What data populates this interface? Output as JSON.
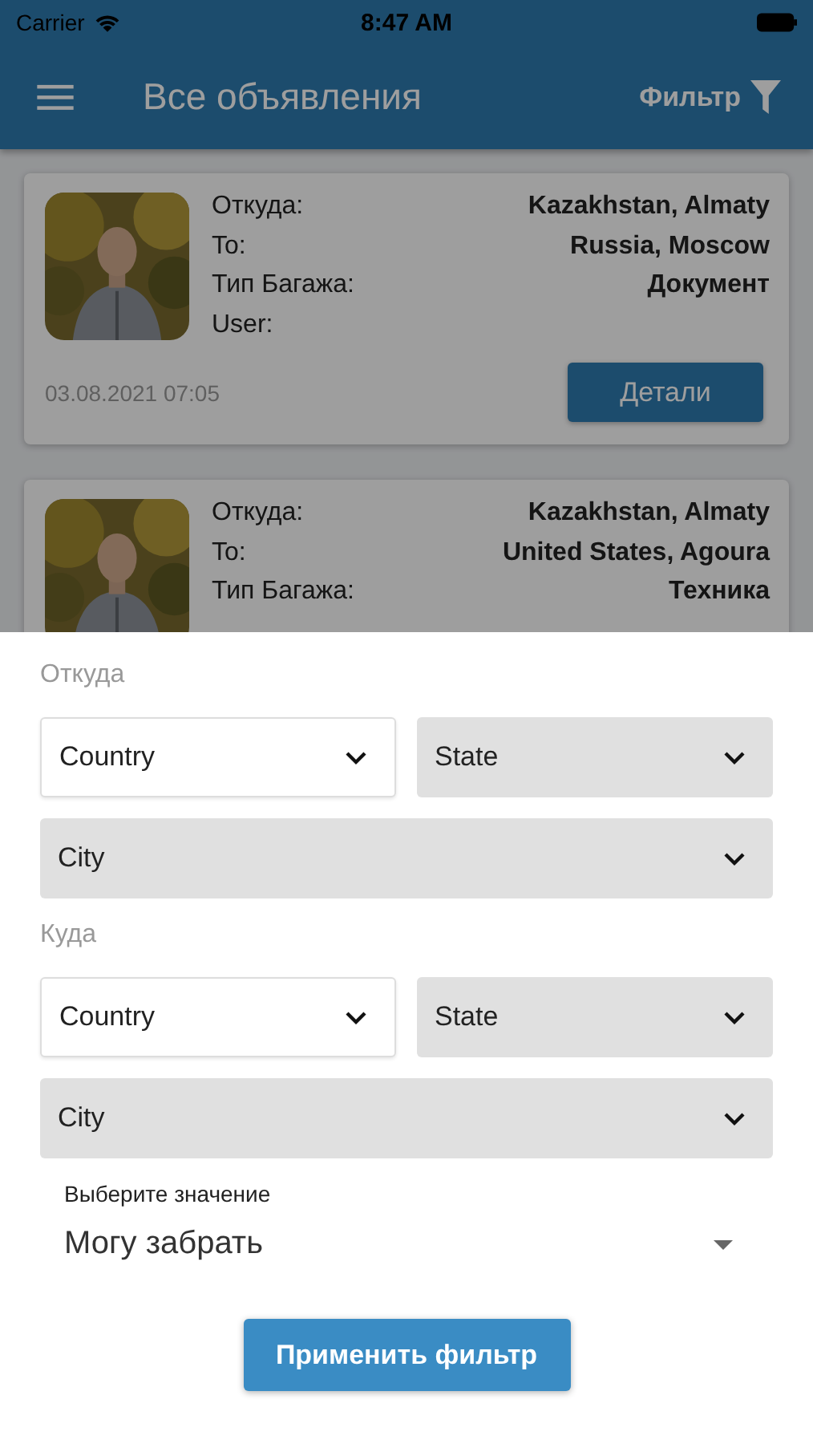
{
  "status_bar": {
    "carrier": "Carrier",
    "time": "8:47 AM"
  },
  "app_bar": {
    "title": "Все объявления",
    "filter_label": "Фильтр"
  },
  "listings": [
    {
      "kind": "picture",
      "rows": [
        {
          "label": "Откуда:",
          "value": "Kazakhstan, Almaty"
        },
        {
          "label": "To:",
          "value": "Russia, Moscow"
        },
        {
          "label": "Тип Багажа:",
          "value": "Документ"
        },
        {
          "label": "User:",
          "value": ""
        }
      ],
      "date": "03.08.2021 07:05",
      "button": "Детали"
    },
    {
      "kind": "picture",
      "rows": [
        {
          "label": "Откуда:",
          "value": "Kazakhstan, Almaty"
        },
        {
          "label": "To:",
          "value": "United States, Agoura"
        },
        {
          "label": "Тип Багажа:",
          "value": "Техника"
        }
      ]
    }
  ],
  "filter_sheet": {
    "sections": [
      {
        "title": "Откуда",
        "fields": [
          {
            "placeholder": "Country",
            "disabled": false
          },
          {
            "placeholder": "State",
            "disabled": true
          },
          {
            "placeholder": "City",
            "disabled": true
          }
        ]
      },
      {
        "title": "Куда",
        "fields": [
          {
            "placeholder": "Country",
            "disabled": false
          },
          {
            "placeholder": "State",
            "disabled": true
          },
          {
            "placeholder": "City",
            "disabled": true
          }
        ]
      }
    ],
    "select": {
      "label": "Выберите значение",
      "value": "Могу забрать"
    },
    "apply_button": "Применить фильтр"
  }
}
